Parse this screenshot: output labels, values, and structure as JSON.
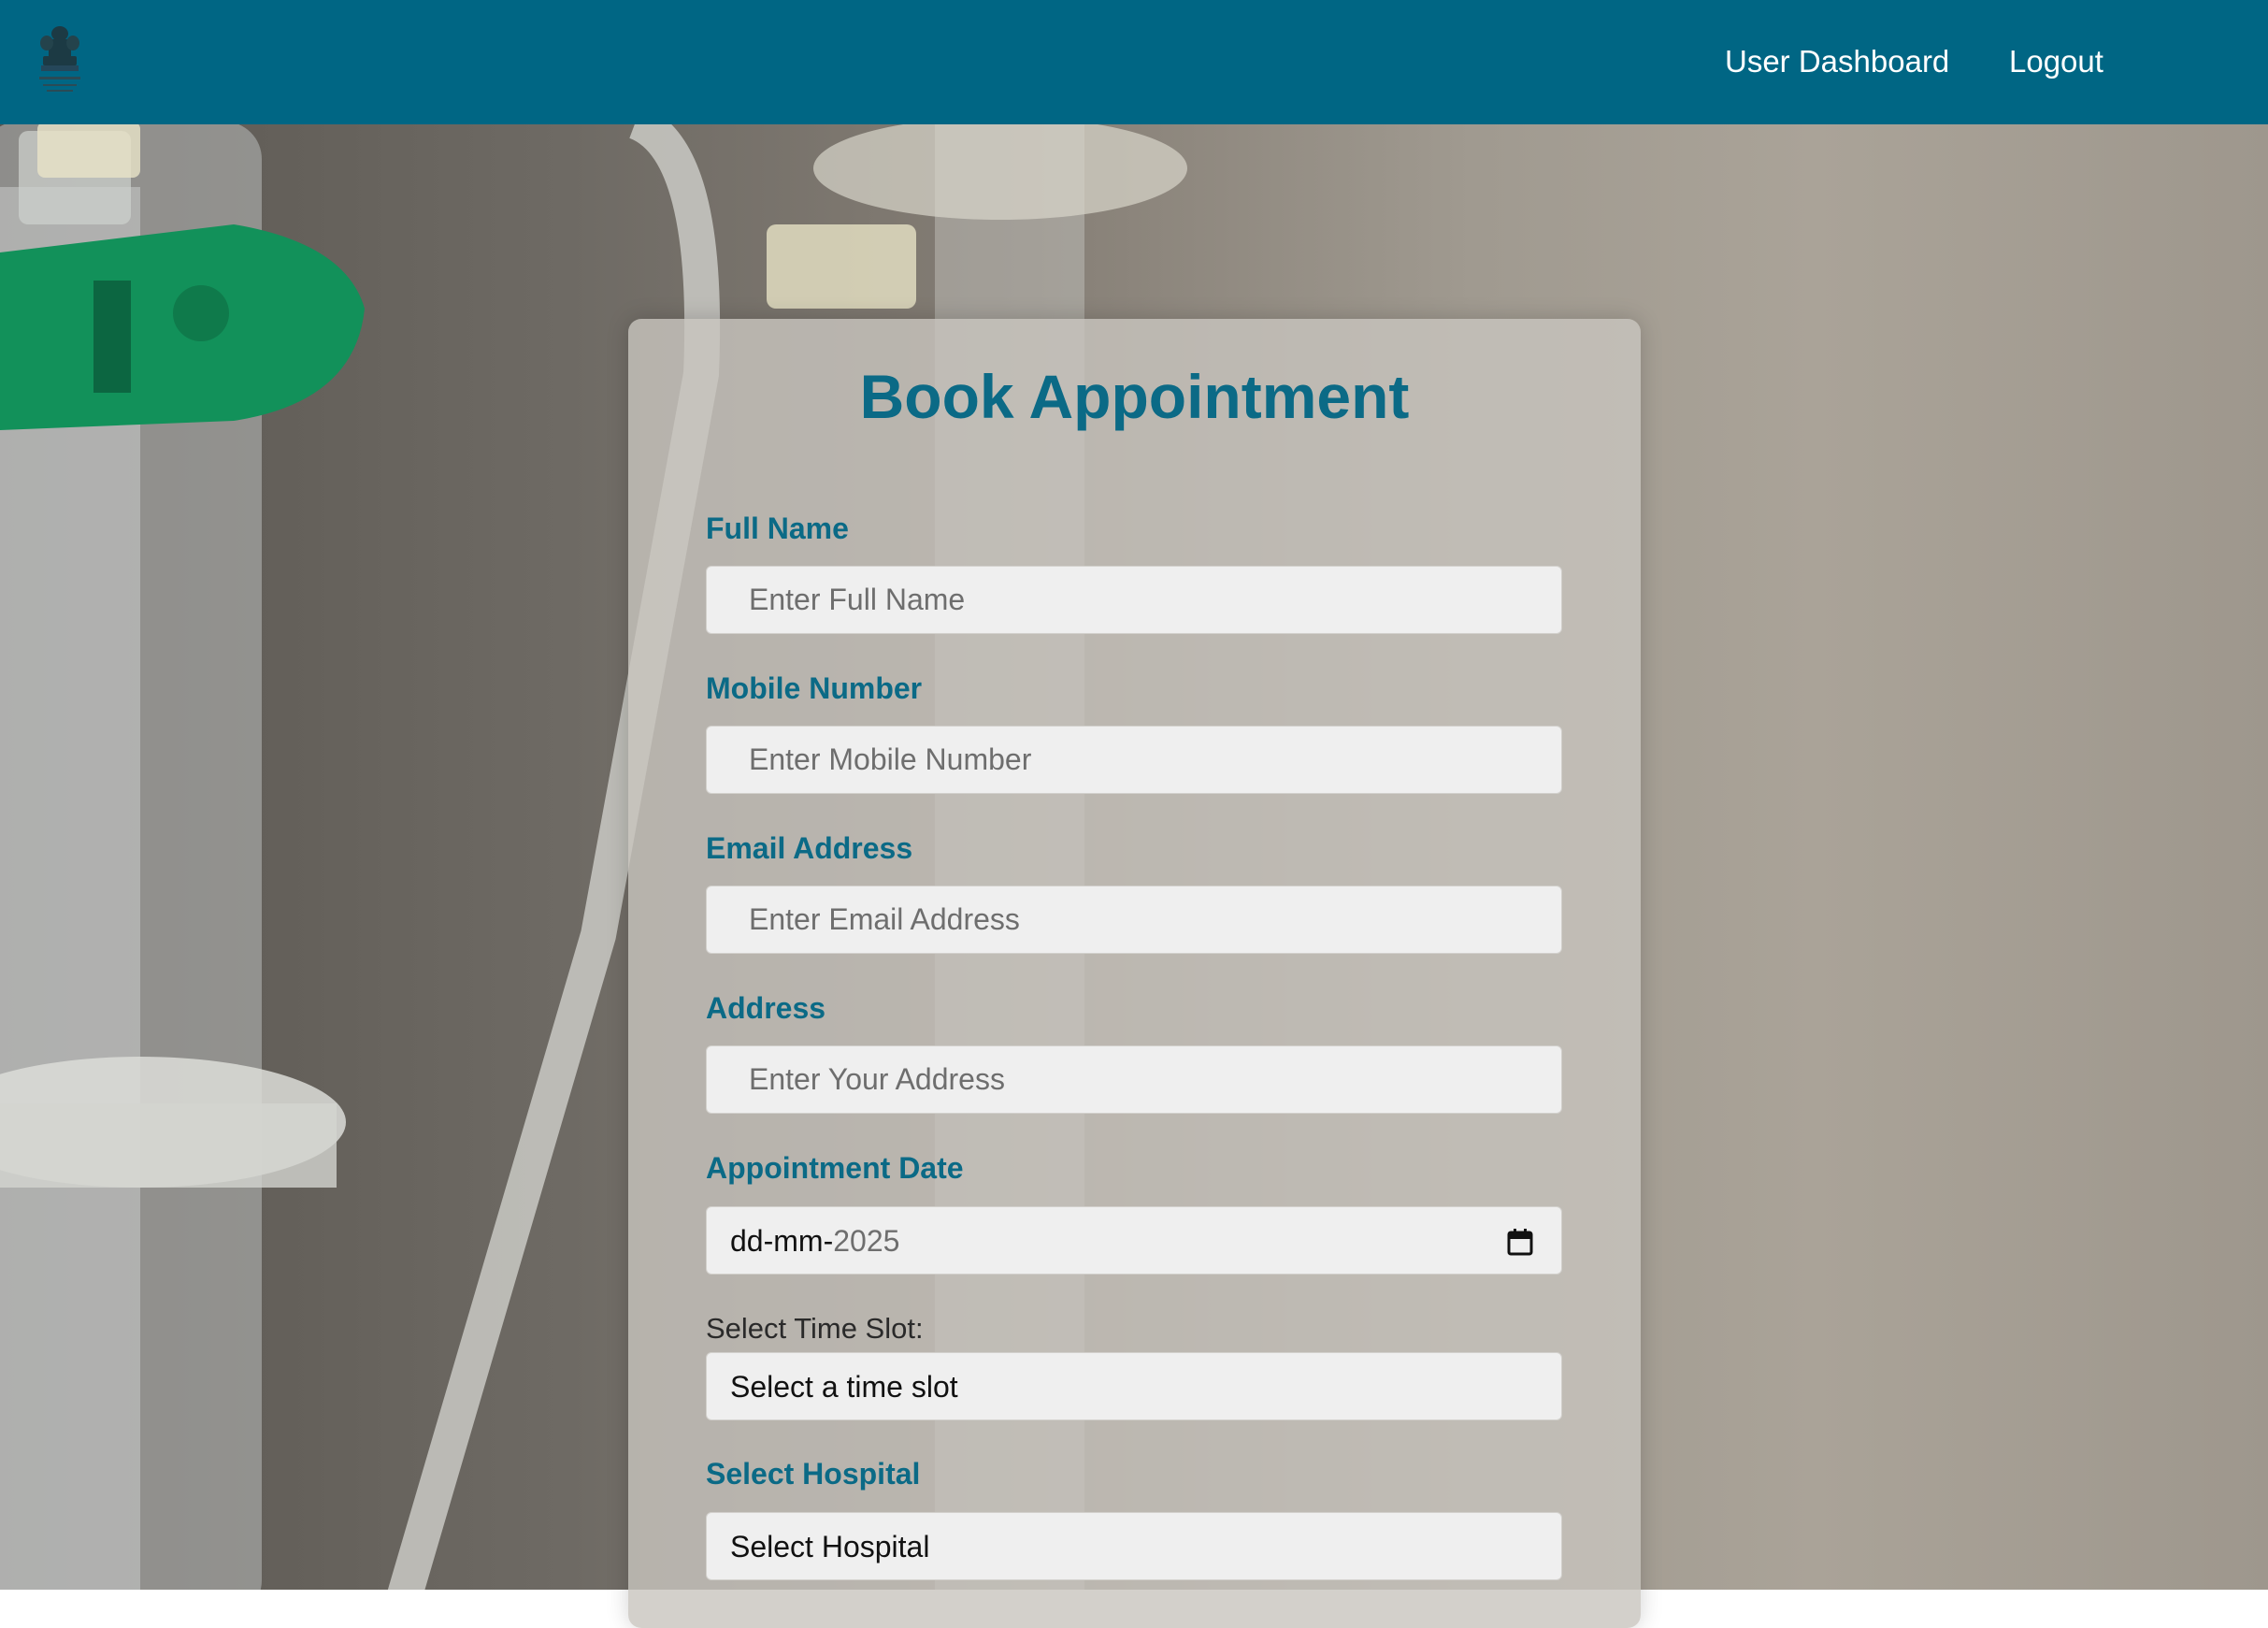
{
  "navbar": {
    "background_color": "#006684",
    "logo_icon": "national-emblem-icon",
    "links": [
      {
        "label": "User Dashboard"
      },
      {
        "label": "Logout"
      }
    ]
  },
  "form": {
    "title": "Book Appointment",
    "accent_color": "#0b6a86",
    "full_name": {
      "label": "Full Name",
      "placeholder": "Enter Full Name"
    },
    "mobile": {
      "label": "Mobile Number",
      "placeholder": "Enter Mobile Number"
    },
    "email": {
      "label": "Email Address",
      "placeholder": "Enter Email Address"
    },
    "address": {
      "label": "Address",
      "placeholder": "Enter Your Address"
    },
    "appointment_date": {
      "label": "Appointment Date",
      "value_prefix": "dd-mm-",
      "value_year": "2025",
      "icon": "calendar-icon"
    },
    "time_slot": {
      "label": "Select Time Slot:",
      "selected": "Select a time slot"
    },
    "hospital": {
      "label": "Select Hospital",
      "selected": "Select Hospital"
    }
  }
}
